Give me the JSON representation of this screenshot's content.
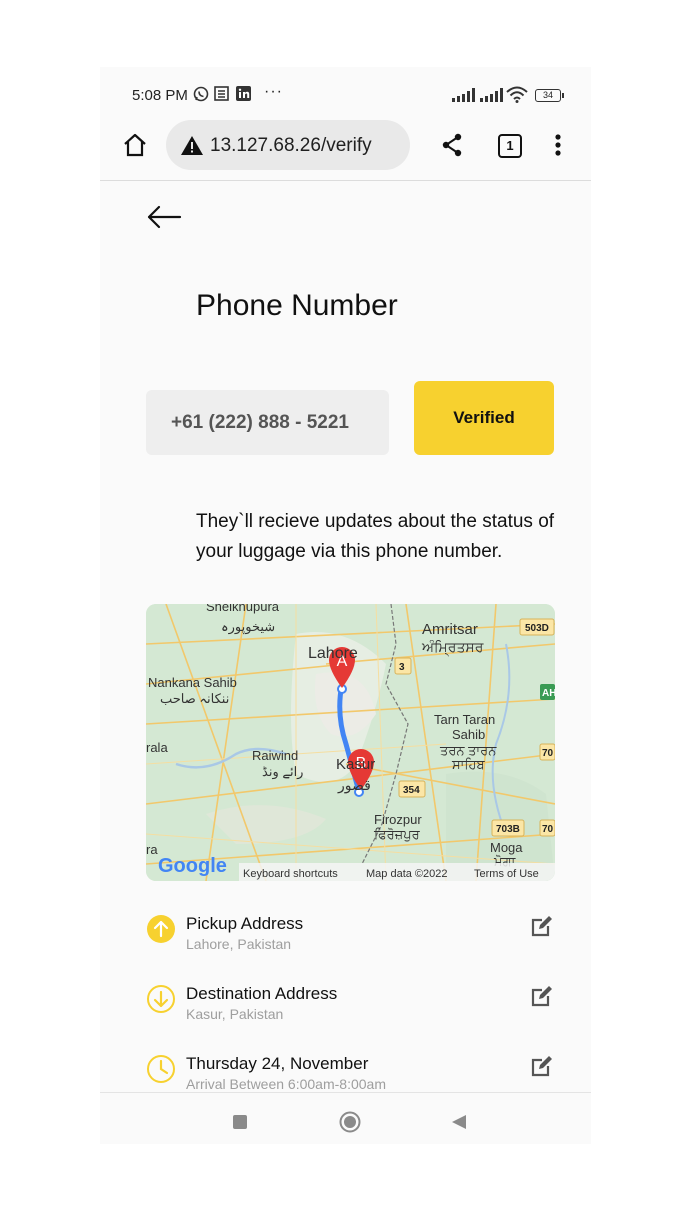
{
  "status_bar": {
    "time": "5:08 PM",
    "more": "···",
    "battery": "34"
  },
  "browser": {
    "url": "13.127.68.26/verify",
    "tab_count": "1"
  },
  "page": {
    "title": "Phone Number",
    "phone_value": "+61 (222) 888 - 5221",
    "verify_label": "Verified",
    "description": "They`ll recieve updates about the status of your luggage via this phone number."
  },
  "map": {
    "marker_a": "A",
    "marker_b": "B",
    "places": {
      "sheikhupura": "Sheikhupura",
      "sheikhupura_ur": "شیخوپورہ",
      "lahore": "Lahore",
      "amritsar": "Amritsar",
      "amritsar_pa": "ਅੰਮ੍ਰਿਤਸਰ",
      "nankana": "Nankana Sahib",
      "nankana_ur": "ننکانہ صاحب",
      "tarn_taran": "Tarn Taran",
      "sahib": "Sahib",
      "tarn_taran_pa": "ਤਰਨ ਤਾਰਨ",
      "sahib_pa": "ਸਾਹਿਬ",
      "raiwind": "Raiwind",
      "raiwind_ur": "رائے ونڈ",
      "kasur": "Kasur",
      "kasur_ur": "قصور",
      "firozpur": "Firozpur",
      "firozpur_pa": "ਫਿਰੋਜ਼ਪੁਰ",
      "moga": "Moga",
      "moga_pa": "ਮੋਗਾ",
      "wala": "rala",
      "ra": "ra"
    },
    "roads": [
      "503D",
      "3",
      "AH",
      "70",
      "354",
      "703B",
      "70"
    ],
    "google": "Google",
    "footer": {
      "shortcuts": "Keyboard shortcuts",
      "map_data": "Map data ©2022",
      "terms": "Terms of Use"
    }
  },
  "details": [
    {
      "label": "Pickup Address",
      "sub": "Lahore, Pakistan"
    },
    {
      "label": "Destination Address",
      "sub": "Kasur, Pakistan"
    },
    {
      "label": "Thursday 24, November",
      "sub": "Arrival Between 6:00am-8:00am"
    }
  ],
  "colors": {
    "accent": "#f7d12f",
    "map_water": "#cfe3d6",
    "marker": "#e53935",
    "route": "#4285f4"
  }
}
